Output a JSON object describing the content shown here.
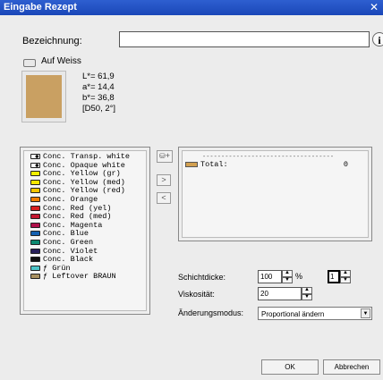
{
  "window": {
    "title": "Eingabe Rezept",
    "close_glyph": "✕"
  },
  "name_field": {
    "label": "Bezeichnung:",
    "value": "",
    "info_glyph": "i"
  },
  "auf_weiss": {
    "label": "Auf Weiss",
    "checked": false
  },
  "color_preview": {
    "swatch_color": "#c9a062"
  },
  "lab_values": {
    "L": "L*= 61,9",
    "a": "a*= 14,4",
    "b": "b*= 36,8",
    "illuminant": "[D50, 2°]"
  },
  "colorant_list": [
    {
      "label": "Conc. Transp. white",
      "color": "#ffffff"
    },
    {
      "label": "Conc. Opaque white",
      "color": "#ffffff"
    },
    {
      "label": "Conc. Yellow (gr)",
      "color": "#f2f000"
    },
    {
      "label": "Conc. Yellow (med)",
      "color": "#f6e800"
    },
    {
      "label": "Conc. Yellow (red)",
      "color": "#f5c500"
    },
    {
      "label": "Conc. Orange",
      "color": "#ef7d00"
    },
    {
      "label": "Conc. Red (yel)",
      "color": "#d82020"
    },
    {
      "label": "Conc. Red (med)",
      "color": "#c41830"
    },
    {
      "label": "Conc. Magenta",
      "color": "#b0104a"
    },
    {
      "label": "Conc. Blue",
      "color": "#1560b0"
    },
    {
      "label": "Conc. Green",
      "color": "#0d8a70"
    },
    {
      "label": "Conc. Violet",
      "color": "#28205a"
    },
    {
      "label": "Conc. Black",
      "color": "#111111"
    },
    {
      "label": "ƒ Grün",
      "color": "#4dc4c8"
    },
    {
      "label": "ƒ Leftover BRAUN",
      "color": "#a89060"
    }
  ],
  "transfer_buttons": {
    "add": "+",
    "move_right": ">",
    "move_left": "<"
  },
  "recipe_panel": {
    "divider": "-----------------------------------",
    "total_label": "Total:",
    "total_value": "0",
    "total_color": "#d2a050"
  },
  "settings": {
    "schichtdicke_label": "Schichtdicke:",
    "schichtdicke_value": "100",
    "schichtdicke_unit": "%",
    "schichtdicke_second_value": "1",
    "viskositaet_label": "Viskosität:",
    "viskositaet_value": "20",
    "aenderungsmodus_label": "Änderungsmodus:",
    "aenderungsmodus_value": "Proportional ändern"
  },
  "buttons": {
    "ok": "OK",
    "cancel": "Abbrechen"
  }
}
